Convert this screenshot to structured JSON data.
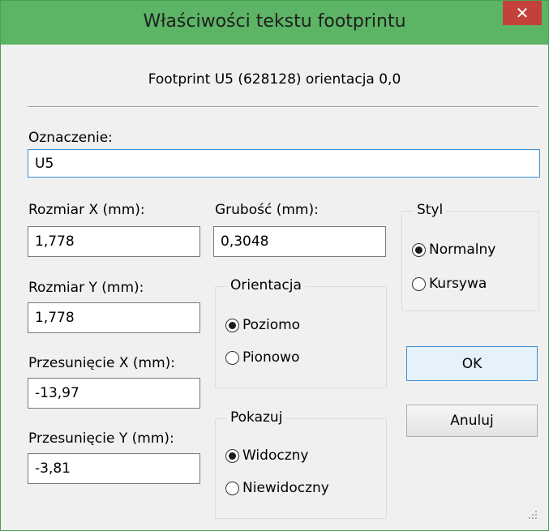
{
  "window": {
    "title": "Właściwości tekstu footprintu",
    "close_glyph": "✕"
  },
  "header": {
    "info": "Footprint U5 (628128) orientacja 0,0"
  },
  "reference": {
    "label": "Oznaczenie:",
    "value": "U5"
  },
  "size_x": {
    "label": "Rozmiar X (mm):",
    "value": "1,778"
  },
  "size_y": {
    "label": "Rozmiar Y (mm):",
    "value": "1,778"
  },
  "offset_x": {
    "label": "Przesunięcie X (mm):",
    "value": "-13,97"
  },
  "offset_y": {
    "label": "Przesunięcie Y (mm):",
    "value": "-3,81"
  },
  "thickness": {
    "label": "Grubość (mm):",
    "value": "0,3048"
  },
  "orientation": {
    "title": "Orientacja",
    "options": [
      "Poziomo",
      "Pionowo"
    ],
    "selected": "Poziomo"
  },
  "visibility": {
    "title": "Pokazuj",
    "options": [
      "Widoczny",
      "Niewidoczny"
    ],
    "selected": "Widoczny"
  },
  "style": {
    "title": "Styl",
    "options": [
      "Normalny",
      "Kursywa"
    ],
    "selected": "Normalny"
  },
  "buttons": {
    "ok": "OK",
    "cancel": "Anuluj"
  },
  "colors": {
    "titlebar": "#5cb465",
    "close": "#c4413a",
    "focus_border": "#3c8ed8"
  }
}
